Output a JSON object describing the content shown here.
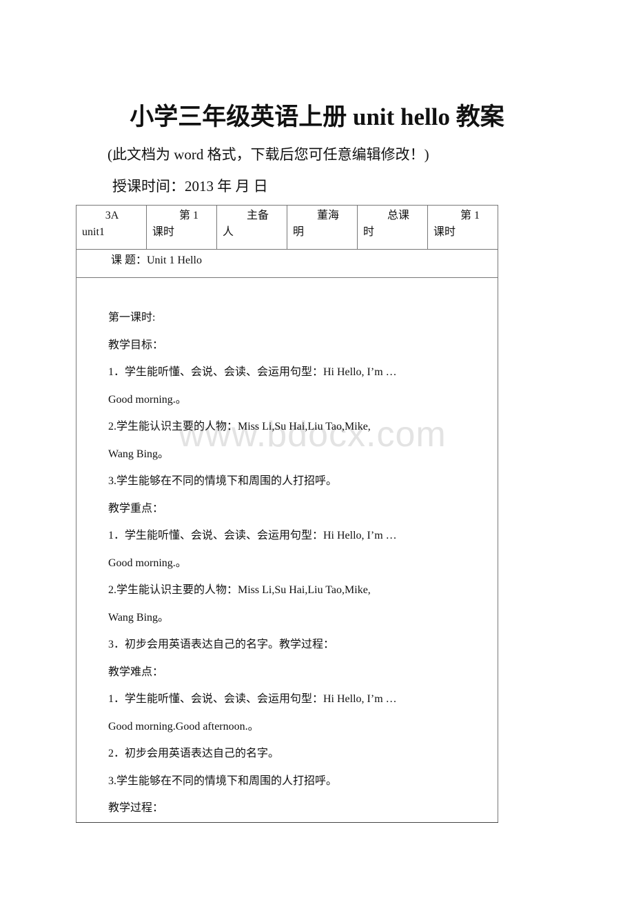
{
  "document": {
    "title": "小学三年级英语上册 unit hello 教案",
    "note": "(此文档为 word 格式，下载后您可任意编辑修改！)",
    "teach_date": "授课时间：2013 年 月 日"
  },
  "table": {
    "header_cells": [
      {
        "top": "3A",
        "bottom": "unit1"
      },
      {
        "top": "第 1",
        "bottom": "课时"
      },
      {
        "top": "主备",
        "bottom": "人"
      },
      {
        "top": "董海",
        "bottom": "明"
      },
      {
        "top": "总课",
        "bottom": "时"
      },
      {
        "top": "第 1",
        "bottom": "课时"
      }
    ],
    "topic": "课 题：Unit 1 Hello",
    "content_lines": [
      "第一课时:",
      "教学目标：",
      "1．学生能听懂、会说、会读、会运用句型：Hi Hello, I’m …",
      "Good morning.。",
      "2.学生能认识主要的人物：Miss Li,Su Hai,Liu Tao,Mike,",
      "Wang Bing。",
      "3.学生能够在不同的情境下和周围的人打招呼。",
      "教学重点：",
      "1．学生能听懂、会说、会读、会运用句型：Hi Hello, I’m …",
      "Good morning.。",
      "2.学生能认识主要的人物：Miss Li,Su Hai,Liu Tao,Mike,",
      "Wang Bing。",
      "3．初步会用英语表达自己的名字。教学过程：",
      "教学难点：",
      "1．学生能听懂、会说、会读、会运用句型：Hi Hello, I’m …",
      "Good morning.Good afternoon.。",
      "2．初步会用英语表达自己的名字。",
      "3.学生能够在不同的情境下和周围的人打招呼。",
      "教学过程："
    ]
  },
  "watermark": "www.bdocx.com"
}
